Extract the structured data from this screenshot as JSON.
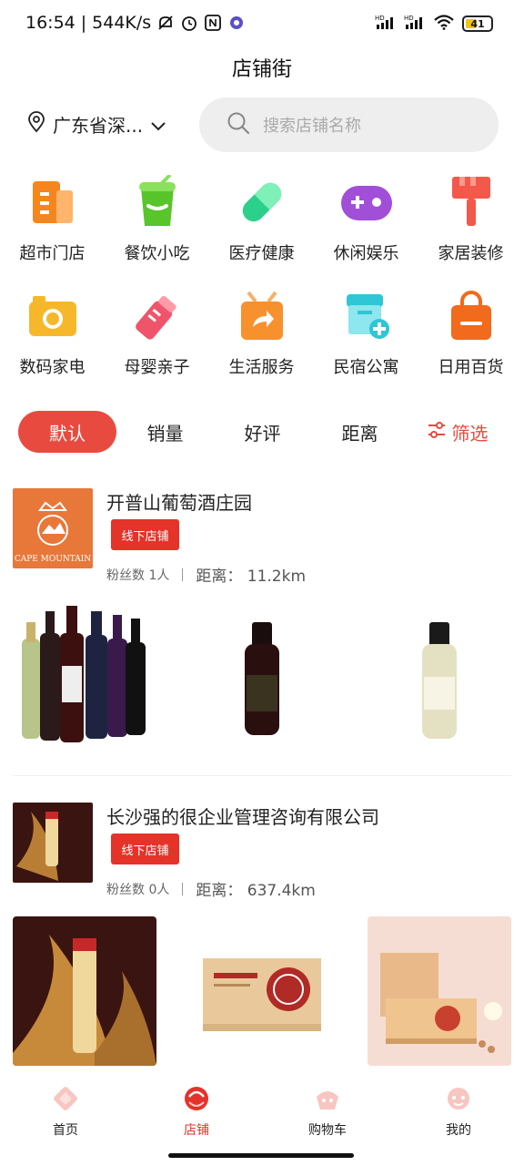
{
  "status_bar": {
    "time": "16:54",
    "net_speed": "544K/s",
    "battery": "41"
  },
  "page_title": "店铺街",
  "location": "广东省深...",
  "search": {
    "placeholder": "搜索店铺名称"
  },
  "categories": [
    {
      "label": "超市门店",
      "icon": "supermarket-icon",
      "color": "#f5861f"
    },
    {
      "label": "餐饮小吃",
      "icon": "drink-cup-icon",
      "color": "#58c52a"
    },
    {
      "label": "医疗健康",
      "icon": "capsule-icon",
      "color": "#2bd18a"
    },
    {
      "label": "休闲娱乐",
      "icon": "gamepad-icon",
      "color": "#a14fd8"
    },
    {
      "label": "家居装修",
      "icon": "paint-brush-icon",
      "color": "#f4584a"
    },
    {
      "label": "数码家电",
      "icon": "camera-icon",
      "color": "#f6b82a"
    },
    {
      "label": "母婴亲子",
      "icon": "baby-bottle-icon",
      "color": "#f0546a"
    },
    {
      "label": "生活服务",
      "icon": "share-box-icon",
      "color": "#f7912e"
    },
    {
      "label": "民宿公寓",
      "icon": "shop-plus-icon",
      "color": "#2fc6d5"
    },
    {
      "label": "日用百货",
      "icon": "shopping-bag-icon",
      "color": "#f26a1c"
    }
  ],
  "sort": {
    "default": "默认",
    "sales": "销量",
    "rating": "好评",
    "distance": "距离",
    "filter": "筛选"
  },
  "stores": [
    {
      "name": "开普山葡萄酒庄园",
      "tag": "线下店铺",
      "fans": "粉丝数 1人",
      "distance": "距离：  11.2km",
      "logo_text": "CAPE MOUNTAIN"
    },
    {
      "name": "长沙强的很企业管理咨询有限公司",
      "tag": "线下店铺",
      "fans": "粉丝数 0人",
      "distance": "距离：  637.4km"
    }
  ],
  "bottom_nav": [
    {
      "label": "首页",
      "icon": "home-icon"
    },
    {
      "label": "店铺",
      "icon": "store-icon",
      "active": true
    },
    {
      "label": "购物车",
      "icon": "cart-icon"
    },
    {
      "label": "我的",
      "icon": "profile-icon"
    }
  ],
  "colors": {
    "accent": "#e94a3f",
    "tag": "#e5332a"
  }
}
